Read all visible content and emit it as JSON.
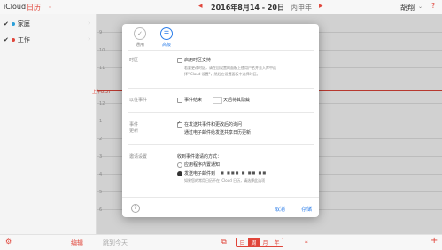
{
  "topbar": {
    "brand": "iCloud",
    "app": "日历",
    "date_range": "2016年8月14 - 20日",
    "year_label": "丙申年",
    "user": "胡翔",
    "accent": "#e0453a"
  },
  "sidebar": {
    "items": [
      {
        "label": "家庭",
        "color": "#2b9fd9"
      },
      {
        "label": "工作",
        "color": "#e0453a"
      }
    ]
  },
  "grid": {
    "hours": [
      "9",
      "10",
      "11",
      "上午8:37",
      "12",
      "1",
      "2",
      "3",
      "4",
      "5",
      "6"
    ]
  },
  "dialog": {
    "tabs": [
      {
        "label": "通用",
        "icon": "checkmark-icon"
      },
      {
        "label": "高级",
        "icon": "advanced-icon"
      }
    ],
    "timezone": {
      "label": "时区",
      "option": "启用时区支持",
      "desc1": "若要更改时区，请在自设置的面板上使用户名并去入库中选",
      "desc2": "择\"iCloud 设置\"，然后在设置面板中选择时区。"
    },
    "past_events": {
      "label": "以往事件",
      "options": [
        "事件结束",
        "天后将其隐藏"
      ]
    },
    "event_updates": {
      "label1": "事件",
      "label2": "更新",
      "opt1": "在发送共事件和更改后的询问",
      "opt2": "通过电子邮件给发送共享日历更新"
    },
    "invitations": {
      "label": "邀请设置",
      "heading": "收到事件邀请的方式：",
      "opt1": "应用程序内置通知",
      "opt2": "发送电子邮件到",
      "note": "如果您的常用日历不在 iCloud 日历，请选择此选项"
    },
    "cancel": "取消",
    "save": "存储",
    "help": "?"
  },
  "bottombar": {
    "edit": "编辑",
    "go_today": "跳到今天",
    "views": [
      "日",
      "周",
      "月",
      "年"
    ],
    "active_view": "周"
  }
}
